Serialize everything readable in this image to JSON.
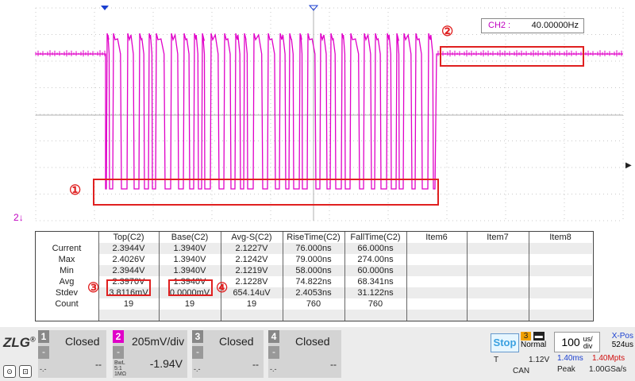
{
  "freq_display": {
    "channel": "CH2 :",
    "value": "40.00000Hz"
  },
  "channel_marker": "2",
  "annotations": {
    "n1": "①",
    "n2": "②",
    "n3": "③",
    "n4": "④"
  },
  "measurements": {
    "columns": [
      "Top(C2)",
      "Base(C2)",
      "Avg-S(C2)",
      "RiseTime(C2)",
      "FallTime(C2)",
      "Item6",
      "Item7",
      "Item8"
    ],
    "rows": [
      {
        "label": "Current",
        "values": [
          "2.3944V",
          "1.3940V",
          "2.1227V",
          "76.000ns",
          "66.000ns",
          "",
          "",
          ""
        ]
      },
      {
        "label": "Max",
        "values": [
          "2.4026V",
          "1.3940V",
          "2.1242V",
          "79.000ns",
          "274.00ns",
          "",
          "",
          ""
        ]
      },
      {
        "label": "Min",
        "values": [
          "2.3944V",
          "1.3940V",
          "2.1219V",
          "58.000ns",
          "60.000ns",
          "",
          "",
          ""
        ]
      },
      {
        "label": "Avg",
        "values": [
          "2.3970V",
          "1.3940V",
          "2.1228V",
          "74.822ns",
          "68.341ns",
          "",
          "",
          ""
        ]
      },
      {
        "label": "Stdev",
        "values": [
          "3.8116mV",
          "0.0000mV",
          "654.14uV",
          "2.4053ns",
          "31.122ns",
          "",
          "",
          ""
        ]
      },
      {
        "label": "Count",
        "values": [
          "19",
          "19",
          "19",
          "760",
          "760",
          "",
          "",
          ""
        ]
      }
    ]
  },
  "channels": [
    {
      "num": "1",
      "state": "Closed",
      "offset": "--",
      "small": "-.-"
    },
    {
      "num": "2",
      "state": "205mV/div",
      "offset": "-1.94V",
      "small": "BwL 5:1 1MΩ"
    },
    {
      "num": "3",
      "state": "Closed",
      "offset": "--",
      "small": "-.-"
    },
    {
      "num": "4",
      "state": "Closed",
      "offset": "--",
      "small": "-.-"
    }
  ],
  "dash": "-",
  "logo": "ZLG",
  "logo_mark": "®",
  "run_state": "Stop",
  "trigger": {
    "source": "3",
    "mode": "Normal",
    "type_label": "T",
    "level": "1.12V",
    "protocol": "CAN"
  },
  "timebase": {
    "value": "100",
    "unit_top": "us/",
    "unit_bottom": "div"
  },
  "xpos": {
    "label": "X-Pos",
    "value": "524us"
  },
  "acq": {
    "time": "1.40ms",
    "points": "1.40Mpts",
    "mode": "Peak",
    "rate": "1.00GSa/s"
  },
  "colors": {
    "trace": "#e000c8",
    "annotation": "#e02020",
    "stop": "#3aa0e0"
  }
}
